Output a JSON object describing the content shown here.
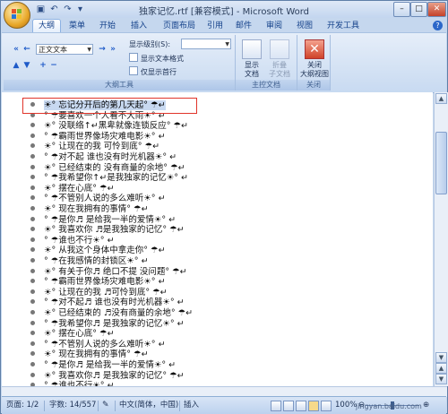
{
  "window": {
    "title": "独家记忆.rtf [兼容模式] - Microsoft Word"
  },
  "quick_access": {
    "save_icon": "save-icon",
    "undo_icon": "undo-icon",
    "redo_icon": "redo-icon",
    "more_icon": "customize-icon"
  },
  "window_controls": {
    "minimize": "–",
    "maximize": "□",
    "close": "✕"
  },
  "tabs": [
    "大纲",
    "菜单",
    "开始",
    "插入",
    "页面布局",
    "引用",
    "邮件",
    "审阅",
    "视图",
    "开发工具"
  ],
  "ribbon": {
    "outline_tools": {
      "level_combo": "正文文本",
      "show_level_label": "显示级别(S):",
      "show_level_value": "",
      "show_text_format": "显示文本格式",
      "show_first_line": "仅显示首行",
      "group_label": "大纲工具"
    },
    "master_document": {
      "show_document": [
        "显示",
        "文档"
      ],
      "collapse_subdocs": [
        "折叠",
        "子文档"
      ],
      "group_label": "主控文档"
    },
    "close": {
      "close_outline": [
        "关闭",
        "大纲视图"
      ],
      "group_label": "关闭"
    }
  },
  "document": {
    "lines": [
      "☀° 忘记分开后的第几天起° ☂↵",
      "° ☂要喜欢一个人看不大雨☀° ↵",
      "☀° 没联络↑↵黑卑就像连锁反应° ☂↵",
      "° ☂霸雨世界像场灾难电影☀° ↵",
      "☀° 让现在的我  可怜到底° ☂↵",
      "° ☂对不起  谁也没有时光机器☀° ↵",
      "☀° 已经结束的  没有商量的余地° ☂↵",
      "° ☂我希望你↑↵是我独家的记忆☀° ↵",
      "☀° 摆在心底° ☂↵",
      "° ☂不管别人说的多么难听☀° ↵",
      "☀° 现在我拥有的事情° ☂↵",
      "° ☂是你♬ 是给我一半的爱情☀° ↵",
      "☀° 我喜欢你 ♬是我独家的记忆° ☂↵",
      "° ☂谁也不行☀° ↵",
      "☀° 从我这个身体中拿走你° ☂↵",
      "° ☂在我感情的封锁区☀° ↵",
      "☀° 有关于你♬ 绝口不提  没问题° ☂↵",
      "° ☂霸雨世界像场灾难电影☀° ↵",
      "☀° 让现在的我 ♬可怜到底° ☂↵",
      "° ☂对不起♬ 谁也没有时光机器☀° ↵",
      "☀° 已经结束的 ♬没有商量的余地° ☂↵",
      "° ☂我希望你♬ 是我独家的记忆☀° ↵",
      "☀° 摆在心底° ☂↵",
      "° ☂不管别人说的多么难听☀° ↵",
      "☀° 现在我拥有的事情° ☂↵",
      "° ☂是你♬ 是给我一半的爱情☀° ↵",
      "☀° 我喜欢你♬ 是我独家的记忆° ☂↵",
      "° ☂谁也不行☀° ↵"
    ]
  },
  "status": {
    "page": "页面: 1/2",
    "words": "字数: 14/557",
    "language": "中文(简体，中国)",
    "mode": "插入",
    "zoom": "100%",
    "watermark": "jingyan.baidu.com"
  }
}
